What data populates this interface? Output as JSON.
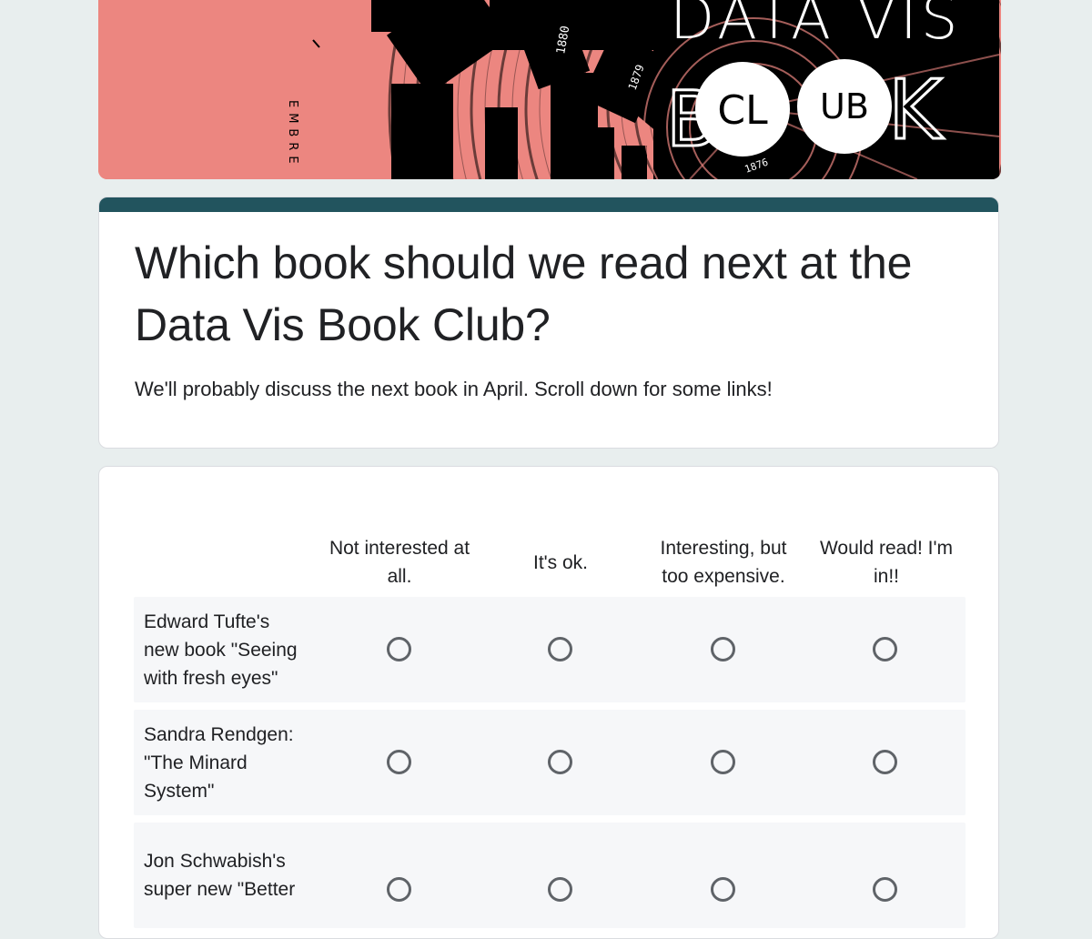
{
  "banner": {
    "colors": {
      "background": "#ec8680",
      "dark": "#000000",
      "light": "#ffffff"
    },
    "vertical_text": "EMBRE",
    "year_labels": [
      "1880",
      "1879",
      "1876"
    ],
    "logo_letters": {
      "top": "DATA VIS",
      "bottom_left": "B",
      "circle1": "CL",
      "circle2": "UB",
      "bottom_right": "K"
    }
  },
  "form": {
    "accent_color": "#22545e",
    "title": "Which book should we read next at the Data Vis Book Club?",
    "title_line1": "Which book should we read next at the",
    "title_line2": "Data Vis Book Club?",
    "description": "We'll probably discuss the next book in April. Scroll down for some links!"
  },
  "grid": {
    "columns": [
      {
        "line1": "Not interested at",
        "line2": "all."
      },
      {
        "line1": "It's ok.",
        "line2": ""
      },
      {
        "line1": "Interesting, but",
        "line2": "too expensive."
      },
      {
        "line1": "Would read! I'm",
        "line2": "in!!"
      }
    ],
    "rows": [
      {
        "lines": [
          "Edward Tufte's",
          "new book \"Seeing",
          "with fresh eyes\""
        ]
      },
      {
        "lines": [
          "Sandra Rendgen:",
          "\"The Minard",
          "System\""
        ]
      },
      {
        "lines": [
          "Jon Schwabish's",
          "super new \"Better",
          ""
        ]
      }
    ]
  }
}
